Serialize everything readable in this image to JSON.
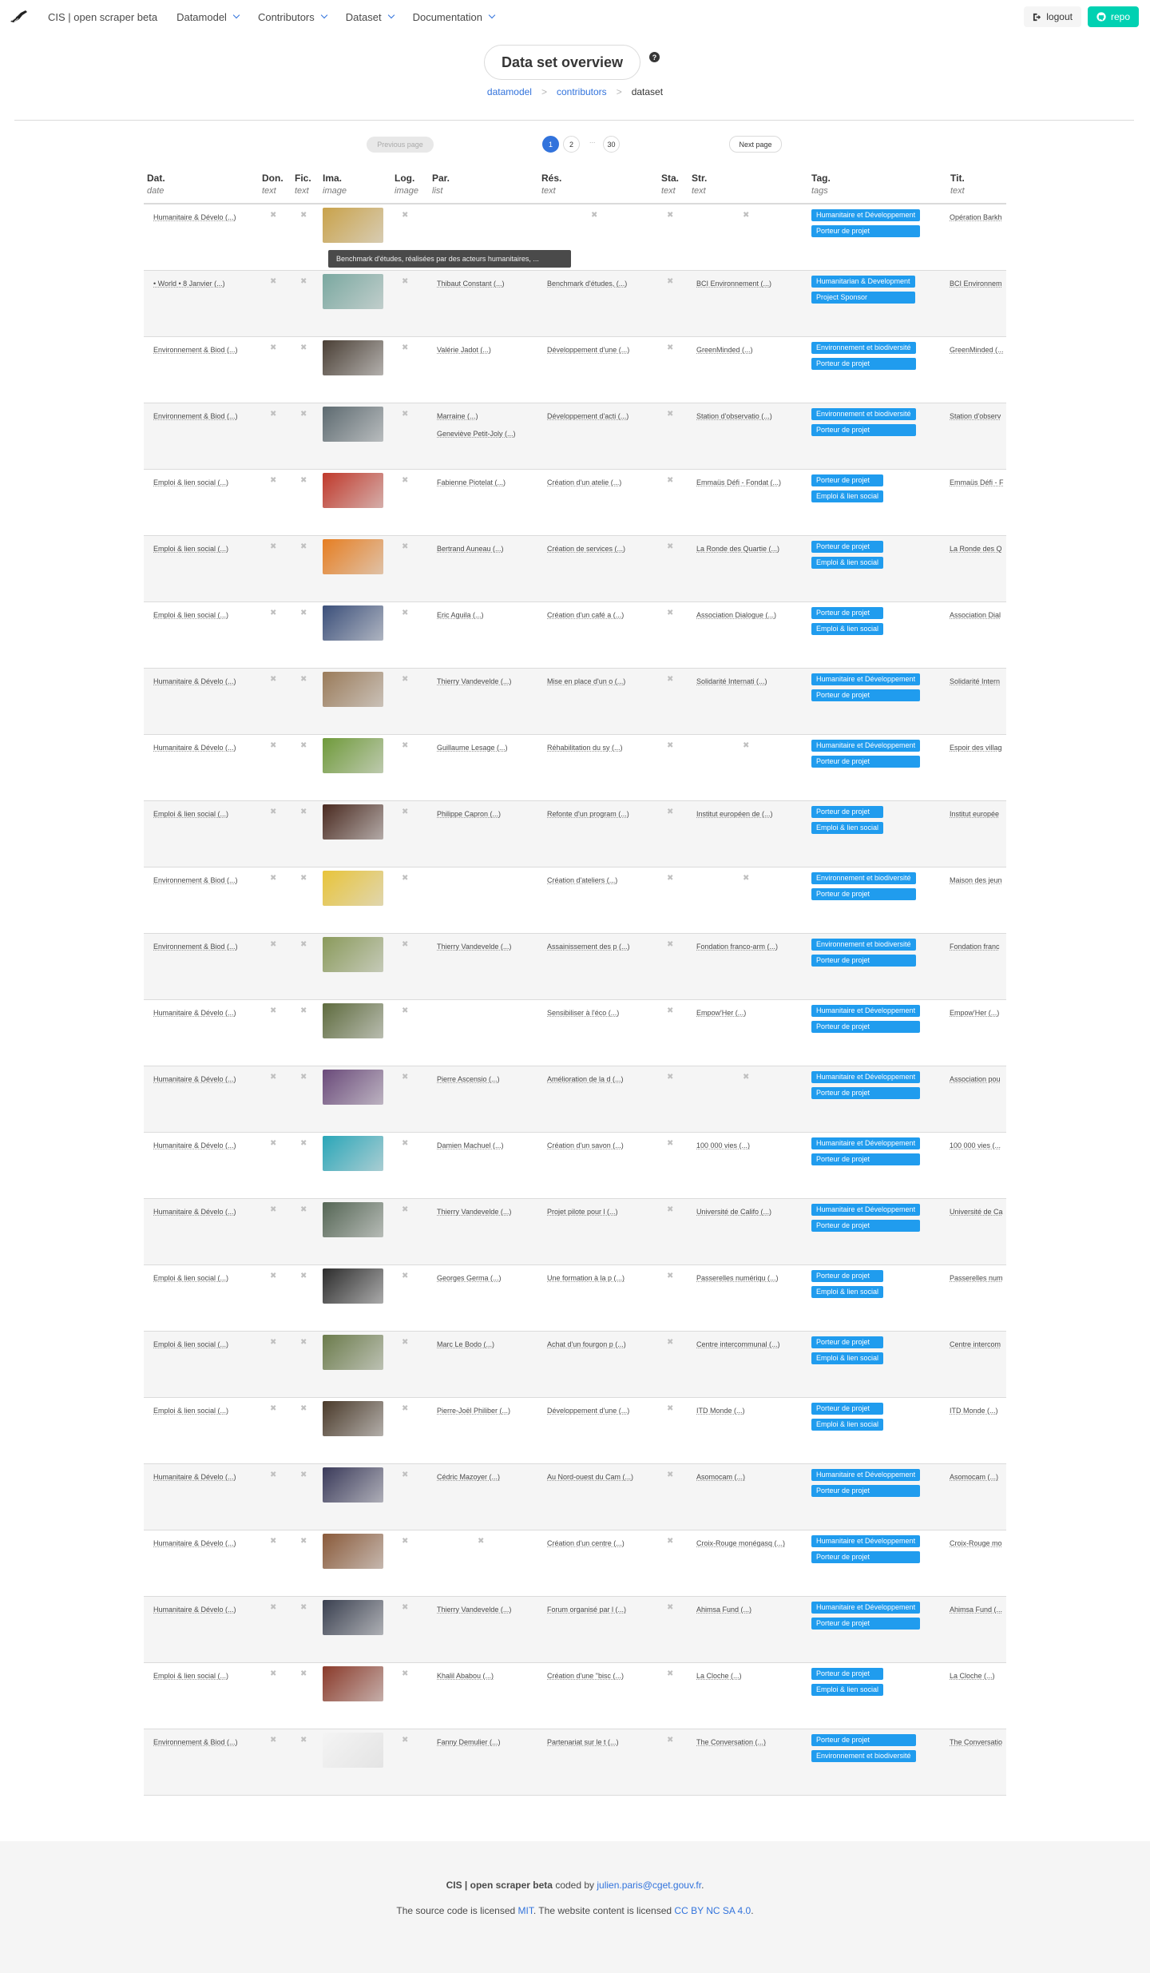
{
  "navbar": {
    "brand_title": "CIS | open scraper beta",
    "menus": [
      "Datamodel",
      "Contributors",
      "Dataset",
      "Documentation"
    ],
    "logout_label": "logout",
    "repo_label": "repo"
  },
  "header": {
    "title": "Data set overview",
    "help_icon": "?",
    "breadcrumb": [
      {
        "label": "datamodel",
        "link": true
      },
      {
        "label": "contributors",
        "link": true
      },
      {
        "label": "dataset",
        "link": false
      }
    ],
    "separator": ">"
  },
  "pagination": {
    "prev_label": "Previous page",
    "next_label": "Next page",
    "pages": [
      "1",
      "2",
      "30"
    ],
    "ellipsis": "...",
    "current": "1"
  },
  "table": {
    "columns": [
      {
        "h": "Dat.",
        "t": "date"
      },
      {
        "h": "Don.",
        "t": "text"
      },
      {
        "h": "Fic.",
        "t": "text"
      },
      {
        "h": "Ima.",
        "t": "image"
      },
      {
        "h": "Log.",
        "t": "image"
      },
      {
        "h": "Par.",
        "t": "list"
      },
      {
        "h": "Rés.",
        "t": "text"
      },
      {
        "h": "Sta.",
        "t": "text"
      },
      {
        "h": "Str.",
        "t": "text"
      },
      {
        "h": "Tag.",
        "t": "tags"
      },
      {
        "h": "Tit.",
        "t": "text"
      }
    ],
    "missing_symbol": "✖",
    "tooltip": "Benchmark d'études, réalisées par des acteurs humanitaires, ...",
    "rows": [
      {
        "dat": "Humanitaire & Dévelo (...)",
        "par": [],
        "par_missing": false,
        "res": "",
        "res_missing": true,
        "str": "",
        "str_missing": true,
        "tags": [
          "Humanitaire et Développement",
          "Porteur de projet"
        ],
        "tit": "Opération Barkh",
        "img": "#c9a24a"
      },
      {
        "dat": "• World • 8 Janvier (...)",
        "par": [
          "Thibaut Constant (...)"
        ],
        "res": "Benchmark d'études, (...)",
        "str": "BCI Environnement (...)",
        "tags": [
          "Humanitarian & Development",
          "Project Sponsor"
        ],
        "tit": "BCI Environnem",
        "img": "#7aa8a0"
      },
      {
        "dat": "Environnement & Biod (...)",
        "par": [
          "Valérie Jadot (...)"
        ],
        "res": "Développement d'une (...)",
        "str": "GreenMinded (...)",
        "tags": [
          "Environnement et biodiversité",
          "Porteur de projet"
        ],
        "tit": "GreenMinded (...",
        "img": "#4a3f35"
      },
      {
        "dat": "Environnement & Biod (...)",
        "par": [
          "Marraine (...)",
          "Geneviève Petit-Joly (...)"
        ],
        "res": "Développement d'acti (...)",
        "str": "Station d'observatio (...)",
        "tags": [
          "Environnement et biodiversité",
          "Porteur de projet"
        ],
        "tit": "Station d'observ",
        "img": "#5d6a70"
      },
      {
        "dat": "Emploi & lien social (...)",
        "par": [
          "Fabienne Piotelat (...)"
        ],
        "res": "Création d'un atelie (...)",
        "str": "Emmaüs Défi - Fondat (...)",
        "tags": [
          "Porteur de projet",
          "Emploi & lien social"
        ],
        "tit": "Emmaüs Défi - F",
        "img": "#c0392b"
      },
      {
        "dat": "Emploi & lien social (...)",
        "par": [
          "Bertrand Auneau (...)"
        ],
        "res": "Création de services (...)",
        "str": "La Ronde des Quartie (...)",
        "tags": [
          "Porteur de projet",
          "Emploi & lien social"
        ],
        "tit": "La Ronde des Q",
        "img": "#e67e22"
      },
      {
        "dat": "Emploi & lien social (...)",
        "par": [
          "Eric Aguila (...)"
        ],
        "res": "Création d'un café a (...)",
        "str": "Association Dialogue (...)",
        "tags": [
          "Porteur de projet",
          "Emploi & lien social"
        ],
        "tit": "Association Dial",
        "img": "#3b4f7a"
      },
      {
        "dat": "Humanitaire & Dévelo (...)",
        "par": [
          "Thierry Vandevelde (...)"
        ],
        "res": "Mise en place d'un o (...)",
        "str": "Solidarité Internati (...)",
        "tags": [
          "Humanitaire et Développement",
          "Porteur de projet"
        ],
        "tit": "Solidarité Intern",
        "img": "#9a7b5a"
      },
      {
        "dat": "Humanitaire & Dévelo (...)",
        "par": [
          "Guillaume Lesage (...)"
        ],
        "res": "Réhabilitation du sy (...)",
        "str": "",
        "str_missing": true,
        "tags": [
          "Humanitaire et Développement",
          "Porteur de projet"
        ],
        "tit": "Espoir des villag",
        "img": "#6f9a3a"
      },
      {
        "dat": "Emploi & lien social (...)",
        "par": [
          "Philippe Capron (...)"
        ],
        "res": "Refonte d'un program (...)",
        "str": "Institut européen de (...)",
        "tags": [
          "Porteur de projet",
          "Emploi & lien social"
        ],
        "tit": "Institut europée",
        "img": "#4a2a20"
      },
      {
        "dat": "Environnement & Biod (...)",
        "par": [],
        "res": "Création d'ateliers (...)",
        "str": "",
        "str_missing": true,
        "tags": [
          "Environnement et biodiversité",
          "Porteur de projet"
        ],
        "tit": "Maison des jeun",
        "img": "#e8c43a"
      },
      {
        "dat": "Environnement & Biod (...)",
        "par": [
          "Thierry Vandevelde (...)"
        ],
        "res": "Assainissement des p (...)",
        "str": "Fondation franco-arm (...)",
        "tags": [
          "Environnement et biodiversité",
          "Porteur de projet"
        ],
        "tit": "Fondation franc",
        "img": "#8a9a5b"
      },
      {
        "dat": "Humanitaire & Dévelo (...)",
        "par": [],
        "res": "Sensibiliser à l'éco (...)",
        "str": "Empow'Her (...)",
        "tags": [
          "Humanitaire et Développement",
          "Porteur de projet"
        ],
        "tit": "Empow'Her (...)",
        "img": "#5e6b3e"
      },
      {
        "dat": "Humanitaire & Dévelo (...)",
        "par": [
          "Pierre Ascensio (...)"
        ],
        "res": "Amélioration de la d (...)",
        "str": "",
        "str_missing": true,
        "tags": [
          "Humanitaire et Développement",
          "Porteur de projet"
        ],
        "tit": "Association pou",
        "img": "#6a4a7a"
      },
      {
        "dat": "Humanitaire & Dévelo (...)",
        "par": [
          "Damien Machuel (...)"
        ],
        "res": "Création d'un savon (...)",
        "str": "100 000 vies (...)",
        "tags": [
          "Humanitaire et Développement",
          "Porteur de projet"
        ],
        "tit": "100 000 vies (...",
        "img": "#2aa6b8"
      },
      {
        "dat": "Humanitaire & Dévelo (...)",
        "par": [
          "Thierry Vandevelde (...)"
        ],
        "res": "Projet pilote pour l (...)",
        "str": "Université de Califo (...)",
        "tags": [
          "Humanitaire et Développement",
          "Porteur de projet"
        ],
        "tit": "Université de Ca",
        "img": "#556655"
      },
      {
        "dat": "Emploi & lien social (...)",
        "par": [
          "Georges Germa (...)"
        ],
        "res": "Une formation à la p (...)",
        "str": "Passerelles numériqu (...)",
        "tags": [
          "Porteur de projet",
          "Emploi & lien social"
        ],
        "tit": "Passerelles num",
        "img": "#2c2c2c"
      },
      {
        "dat": "Emploi & lien social (...)",
        "par": [
          "Marc Le Bodo (...)"
        ],
        "res": "Achat d'un fourgon p (...)",
        "str": "Centre intercommunal (...)",
        "tags": [
          "Porteur de projet",
          "Emploi & lien social"
        ],
        "tit": "Centre intercom",
        "img": "#6b7b4b"
      },
      {
        "dat": "Emploi & lien social (...)",
        "par": [
          "Pierre-Joël Philiber (...)"
        ],
        "res": "Développement d'une (...)",
        "str": "ITD Monde (...)",
        "tags": [
          "Porteur de projet",
          "Emploi & lien social"
        ],
        "tit": "ITD Monde (...)",
        "img": "#4a3a2a"
      },
      {
        "dat": "Humanitaire & Dévelo (...)",
        "par": [
          "Cédric Mazoyer (...)"
        ],
        "res": "Au Nord-ouest du Cam (...)",
        "str": "Asomocam (...)",
        "tags": [
          "Humanitaire et Développement",
          "Porteur de projet"
        ],
        "tit": "Asomocam (...)",
        "img": "#3a3a5a"
      },
      {
        "dat": "Humanitaire & Dévelo (...)",
        "par": [],
        "par_missing": true,
        "res": "Création d'un centre (...)",
        "str": "Croix-Rouge monégasq (...)",
        "tags": [
          "Humanitaire et Développement",
          "Porteur de projet"
        ],
        "tit": "Croix-Rouge mo",
        "img": "#8a5a3a"
      },
      {
        "dat": "Humanitaire & Dévelo (...)",
        "par": [
          "Thierry Vandevelde (...)"
        ],
        "res": "Forum organisé par l (...)",
        "str": "Ahimsa Fund (...)",
        "tags": [
          "Humanitaire et Développement",
          "Porteur de projet"
        ],
        "tit": "Ahimsa Fund (...",
        "img": "#3a4050"
      },
      {
        "dat": "Emploi & lien social (...)",
        "par": [
          "Khalil Ababou (...)"
        ],
        "res": "Création d'une \"bisc (...)",
        "str": "La Cloche (...)",
        "tags": [
          "Porteur de projet",
          "Emploi & lien social"
        ],
        "tit": "La Cloche (...)",
        "img": "#8a3a2a"
      },
      {
        "dat": "Environnement & Biod (...)",
        "par": [
          "Fanny Demulier (...)"
        ],
        "res": "Partenariat sur le t (...)",
        "str": "The Conversation (...)",
        "tags": [
          "Porteur de projet",
          "Environnement et biodiversité"
        ],
        "tit": "The Conversatio",
        "img": "#f4f4f4"
      }
    ]
  },
  "footer": {
    "brand": "CIS | open scraper beta",
    "coded_by": " coded by ",
    "email": "julien.paris@cget.gouv.fr",
    "dot": ".",
    "license_prefix": "The source code is licensed ",
    "license_code": "MIT",
    "license_mid": ". The website content is licensed ",
    "license_content": "CC BY NC SA 4.0",
    "license_end": "."
  },
  "colors": {
    "link": "#3273dc",
    "tag": "#209cee",
    "repo": "#00d1b2",
    "footer_bg": "#f5f5f5"
  }
}
